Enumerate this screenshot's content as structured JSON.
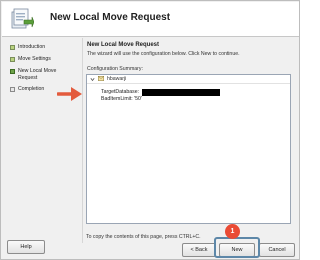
{
  "window": {
    "title": "New Local Move Request"
  },
  "sidebar": {
    "steps": [
      {
        "label": "Introduction",
        "state": "done"
      },
      {
        "label": "Move Settings",
        "state": "done"
      },
      {
        "label": "New Local Move Request",
        "state": "current"
      },
      {
        "label": "Completion",
        "state": "pending"
      }
    ]
  },
  "content": {
    "title": "New Local Move Request",
    "description": "The wizard will use the configuration below.  Click New to continue.",
    "summary_label": "Configuration Summary:",
    "summary_header": "hbawarji",
    "rows": [
      {
        "label": "TargetDatabase:"
      },
      {
        "label": "BadItemLimit: '50'"
      }
    ],
    "copy_hint": "To copy the contents of this page, press CTRL+C."
  },
  "buttons": {
    "help": "Help",
    "back": "< Back",
    "new": "New",
    "cancel": "Cancel"
  },
  "annotations": {
    "badge_number": "1",
    "badge_color": "#ea4b35",
    "arrow_color": "#e35b3d",
    "highlight_color": "#5d87a8"
  }
}
